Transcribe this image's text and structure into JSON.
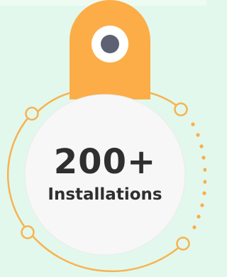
{
  "badge": {
    "count": "200+",
    "label": "Installations"
  },
  "colors": {
    "background": "#e2f8ec",
    "tag": "#fcad47",
    "ring": "#f7b352",
    "circle": "#f7f7f7",
    "pin": "#5e6172",
    "text": "#2f2f2f"
  }
}
